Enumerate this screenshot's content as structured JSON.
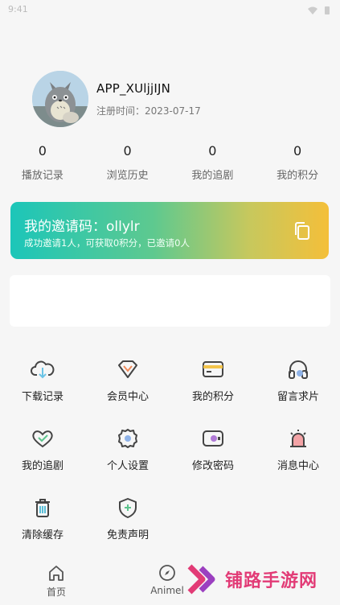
{
  "status_bar": {
    "time": "9:41"
  },
  "profile": {
    "username": "APP_XUljjIJN",
    "reg_label": "注册时间：",
    "reg_date": "2023-07-17"
  },
  "stats": [
    {
      "value": "0",
      "label": "播放记录"
    },
    {
      "value": "0",
      "label": "浏览历史"
    },
    {
      "value": "0",
      "label": "我的追剧"
    },
    {
      "value": "0",
      "label": "我的积分"
    }
  ],
  "invite": {
    "title": "我的邀请码：ollylr",
    "subtitle": "成功邀请1人，可获取0积分，已邀请0人"
  },
  "menu": [
    {
      "label": "下载记录",
      "icon": "cloud-download-icon"
    },
    {
      "label": "会员中心",
      "icon": "vip-icon"
    },
    {
      "label": "我的积分",
      "icon": "wallet-card-icon"
    },
    {
      "label": "留言求片",
      "icon": "headphones-icon"
    },
    {
      "label": "我的追剧",
      "icon": "heart-icon"
    },
    {
      "label": "个人设置",
      "icon": "gear-icon"
    },
    {
      "label": "修改密码",
      "icon": "password-lock-icon"
    },
    {
      "label": "消息中心",
      "icon": "alarm-bell-icon"
    },
    {
      "label": "清除缓存",
      "icon": "trash-icon"
    },
    {
      "label": "免责声明",
      "icon": "shield-icon"
    }
  ],
  "tabbar": {
    "home": "首页",
    "anime": "Animel"
  },
  "watermark": {
    "text": "铺路手游网"
  },
  "colors": {
    "accent": "#5bc8a0",
    "icon_dark": "#444444",
    "watermark": "#e23b76"
  }
}
